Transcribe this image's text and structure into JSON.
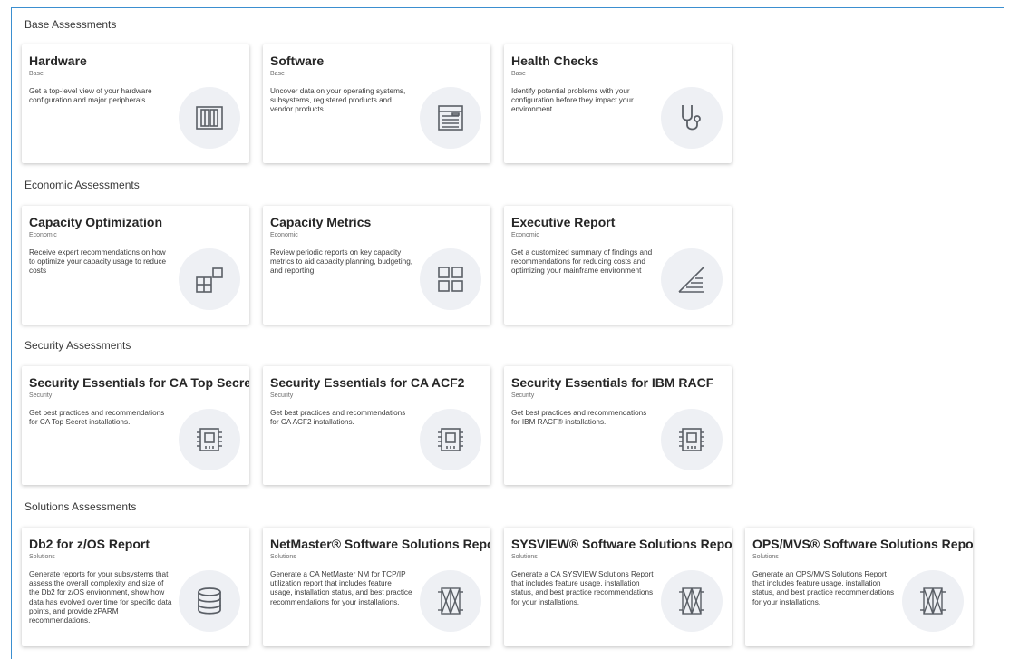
{
  "sections": [
    {
      "title": "Base Assessments"
    },
    {
      "title": "Economic Assessments"
    },
    {
      "title": "Security Assessments"
    },
    {
      "title": "Solutions Assessments"
    }
  ],
  "cards": [
    {
      "title": "Hardware",
      "category": "Base",
      "description": "Get a top-level view of your hardware configuration and major peripherals",
      "icon": "hardware-icon"
    },
    {
      "title": "Software",
      "category": "Base",
      "description": "Uncover data on your operating systems, subsystems, registered products and vendor products",
      "icon": "document-list-icon"
    },
    {
      "title": "Health Checks",
      "category": "Base",
      "description": "Identify potential problems with your configuration before they impact your environment",
      "icon": "stethoscope-icon"
    },
    {
      "title": "Capacity Optimization",
      "category": "Economic",
      "description": "Receive expert recommendations on how to optimize your capacity usage to reduce costs",
      "icon": "blocks-icon"
    },
    {
      "title": "Capacity Metrics",
      "category": "Economic",
      "description": "Review periodic reports on key capacity metrics to aid capacity planning, budgeting, and reporting",
      "icon": "grid-icon"
    },
    {
      "title": "Executive Report",
      "category": "Economic",
      "description": "Get a customized summary of findings and recommendations for reducing costs and optimizing your mainframe environment",
      "icon": "slope-icon"
    },
    {
      "title": "Security Essentials for CA Top Secret",
      "category": "Security",
      "description": "Get best practices and recommendations for CA Top Secret installations.",
      "icon": "chip-icon"
    },
    {
      "title": "Security Essentials for CA ACF2",
      "category": "Security",
      "description": "Get best practices and recommendations for CA ACF2 installations.",
      "icon": "chip-icon"
    },
    {
      "title": "Security Essentials for IBM RACF",
      "category": "Security",
      "description": "Get best practices and recommendations for IBM RACF® installations.",
      "icon": "chip-icon"
    },
    {
      "title": "Db2 for z/OS Report",
      "category": "Solutions",
      "description": "Generate reports for your subsystems that assess the overall complexity and size of the Db2 for z/OS environment, show how data has evolved over time for specific data points, and provide zPARM recommendations.",
      "icon": "database-icon"
    },
    {
      "title": "NetMaster® Software Solutions Report",
      "category": "Solutions",
      "description": "Generate a CA NetMaster NM for TCP/IP utilization report that includes feature usage, installation status, and best practice recommendations for your installations.",
      "icon": "rack-icon"
    },
    {
      "title": "SYSVIEW® Software Solutions Report",
      "category": "Solutions",
      "description": "Generate a CA SYSVIEW Solutions Report that includes feature usage, installation status, and best practice recommendations for your installations.",
      "icon": "rack-icon"
    },
    {
      "title": "OPS/MVS® Software Solutions Report",
      "category": "Solutions",
      "description": "Generate an OPS/MVS Solutions Report that includes feature usage, installation status, and best practice recommendations for your installations.",
      "icon": "rack-icon"
    }
  ],
  "colors": {
    "frame": "#3b8fd0",
    "icon_stroke": "#5a5f66",
    "icon_bg": "#eef0f4"
  }
}
